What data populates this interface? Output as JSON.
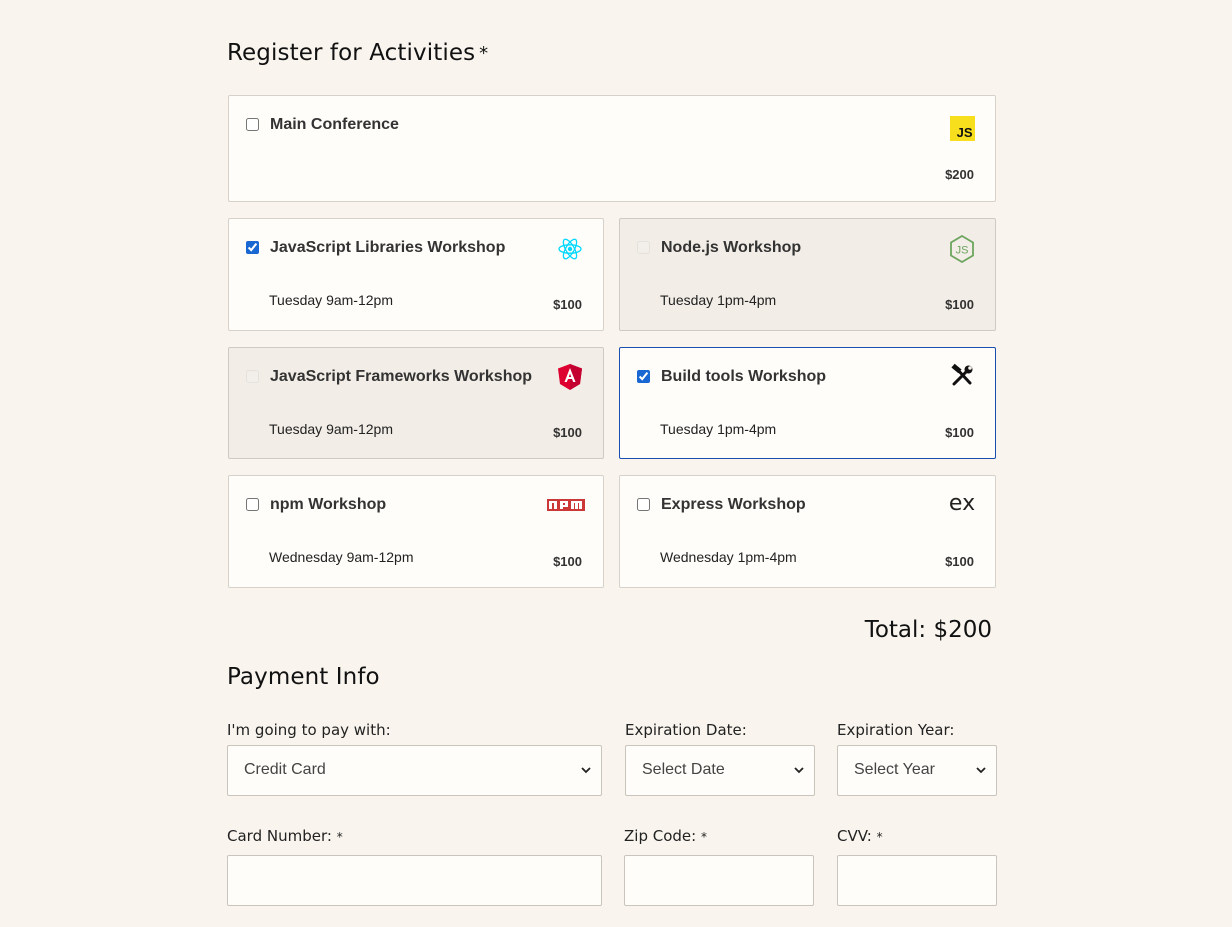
{
  "activities": {
    "heading": "Register for Activities",
    "required_marker": "*",
    "items": [
      {
        "title": "Main Conference",
        "time": "",
        "price": "$200",
        "checked": false,
        "disabled": false
      },
      {
        "title": "JavaScript Libraries Workshop",
        "time": "Tuesday 9am-12pm",
        "price": "$100",
        "checked": true,
        "disabled": false
      },
      {
        "title": "Node.js Workshop",
        "time": "Tuesday 1pm-4pm",
        "price": "$100",
        "checked": false,
        "disabled": true
      },
      {
        "title": "JavaScript Frameworks Workshop",
        "time": "Tuesday 9am-12pm",
        "price": "$100",
        "checked": false,
        "disabled": true
      },
      {
        "title": "Build tools Workshop",
        "time": "Tuesday 1pm-4pm",
        "price": "$100",
        "checked": true,
        "disabled": false
      },
      {
        "title": "npm Workshop",
        "time": "Wednesday 9am-12pm",
        "price": "$100",
        "checked": false,
        "disabled": false
      },
      {
        "title": "Express Workshop",
        "time": "Wednesday 1pm-4pm",
        "price": "$100",
        "checked": false,
        "disabled": false
      }
    ],
    "js_logo_text": "JS",
    "express_logo_text": "ex",
    "total": "Total: $200"
  },
  "payment": {
    "heading": "Payment Info",
    "pay_with_label": "I'm going to pay with:",
    "pay_with_value": "Credit Card",
    "exp_date_label": "Expiration Date:",
    "exp_date_value": "Select Date",
    "exp_year_label": "Expiration Year:",
    "exp_year_value": "Select Year",
    "card_number_label": "Card Number:",
    "zip_label": "Zip Code:",
    "cvv_label": "CVV:",
    "required_marker": "*"
  },
  "colors": {
    "background": "#f9f5ee",
    "card_bg": "#fffdf9",
    "disabled_bg": "#f2ede6",
    "focus_border": "#1a4fb0",
    "react": "#00d8ff",
    "node": "#6da55f",
    "angular": "#dd0031",
    "npm": "#cb3837"
  }
}
